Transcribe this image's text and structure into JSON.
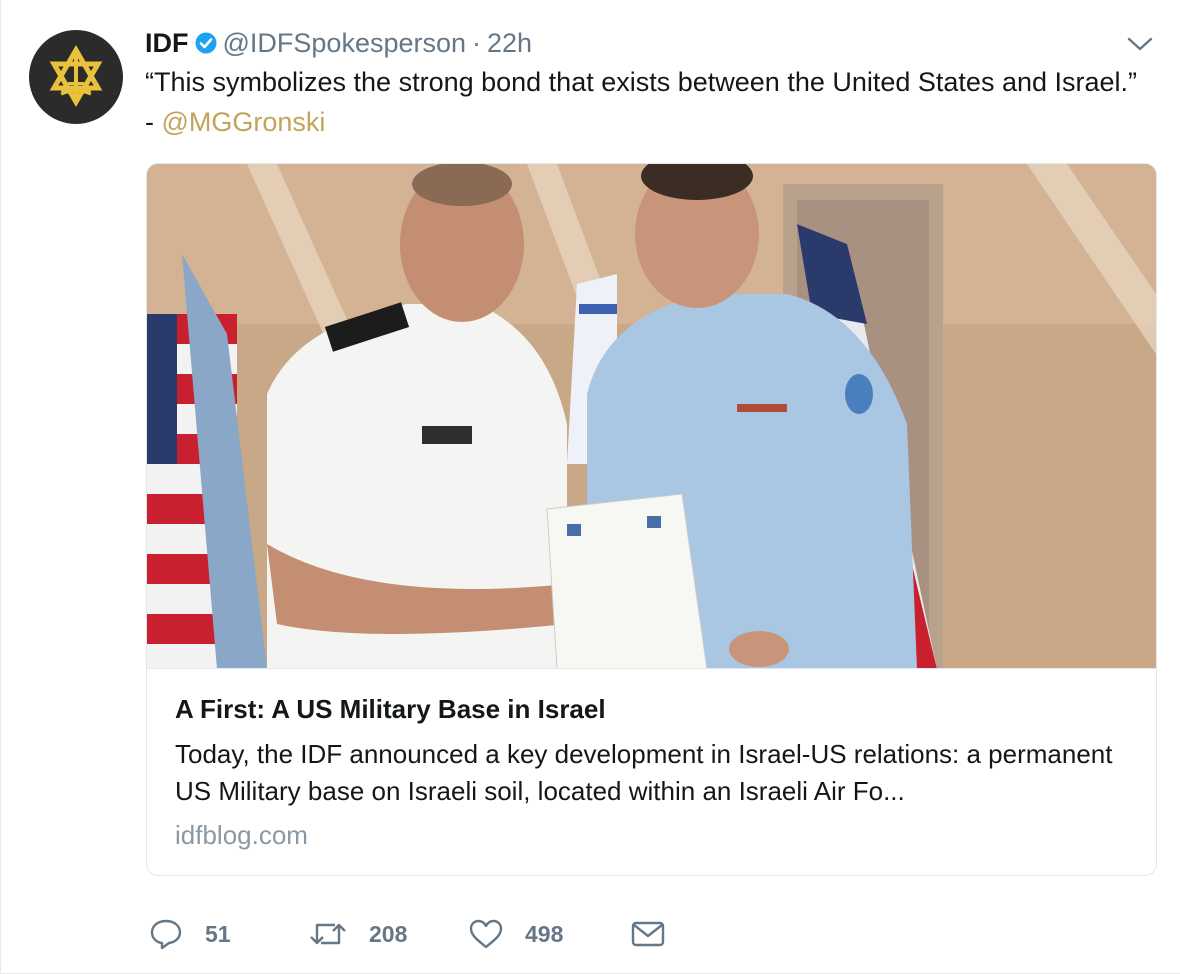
{
  "author": {
    "name": "IDF",
    "handle": "@IDFSpokesperson",
    "separator": "·",
    "time": "22h",
    "verified": true,
    "avatar_icon": "idf-emblem-icon"
  },
  "tweet": {
    "text_before_mention": "“This symbolizes the strong bond that exists between the United States and Israel.” - ",
    "mention": "@MGGronski"
  },
  "card": {
    "image_icon": "photo-two-officers-holding-document",
    "title": "A First: A US Military Base in Israel",
    "description": "Today, the IDF announced a key development in Israel-US relations: a permanent US Military base on Israeli soil, located within an Israeli Air Fo...",
    "domain": "idfblog.com"
  },
  "actions": {
    "reply_count": "51",
    "retweet_count": "208",
    "like_count": "498"
  },
  "colors": {
    "mention": "#c2a35a",
    "verified": "#1da1f2",
    "muted": "#657786",
    "border": "#e1e8ed"
  }
}
